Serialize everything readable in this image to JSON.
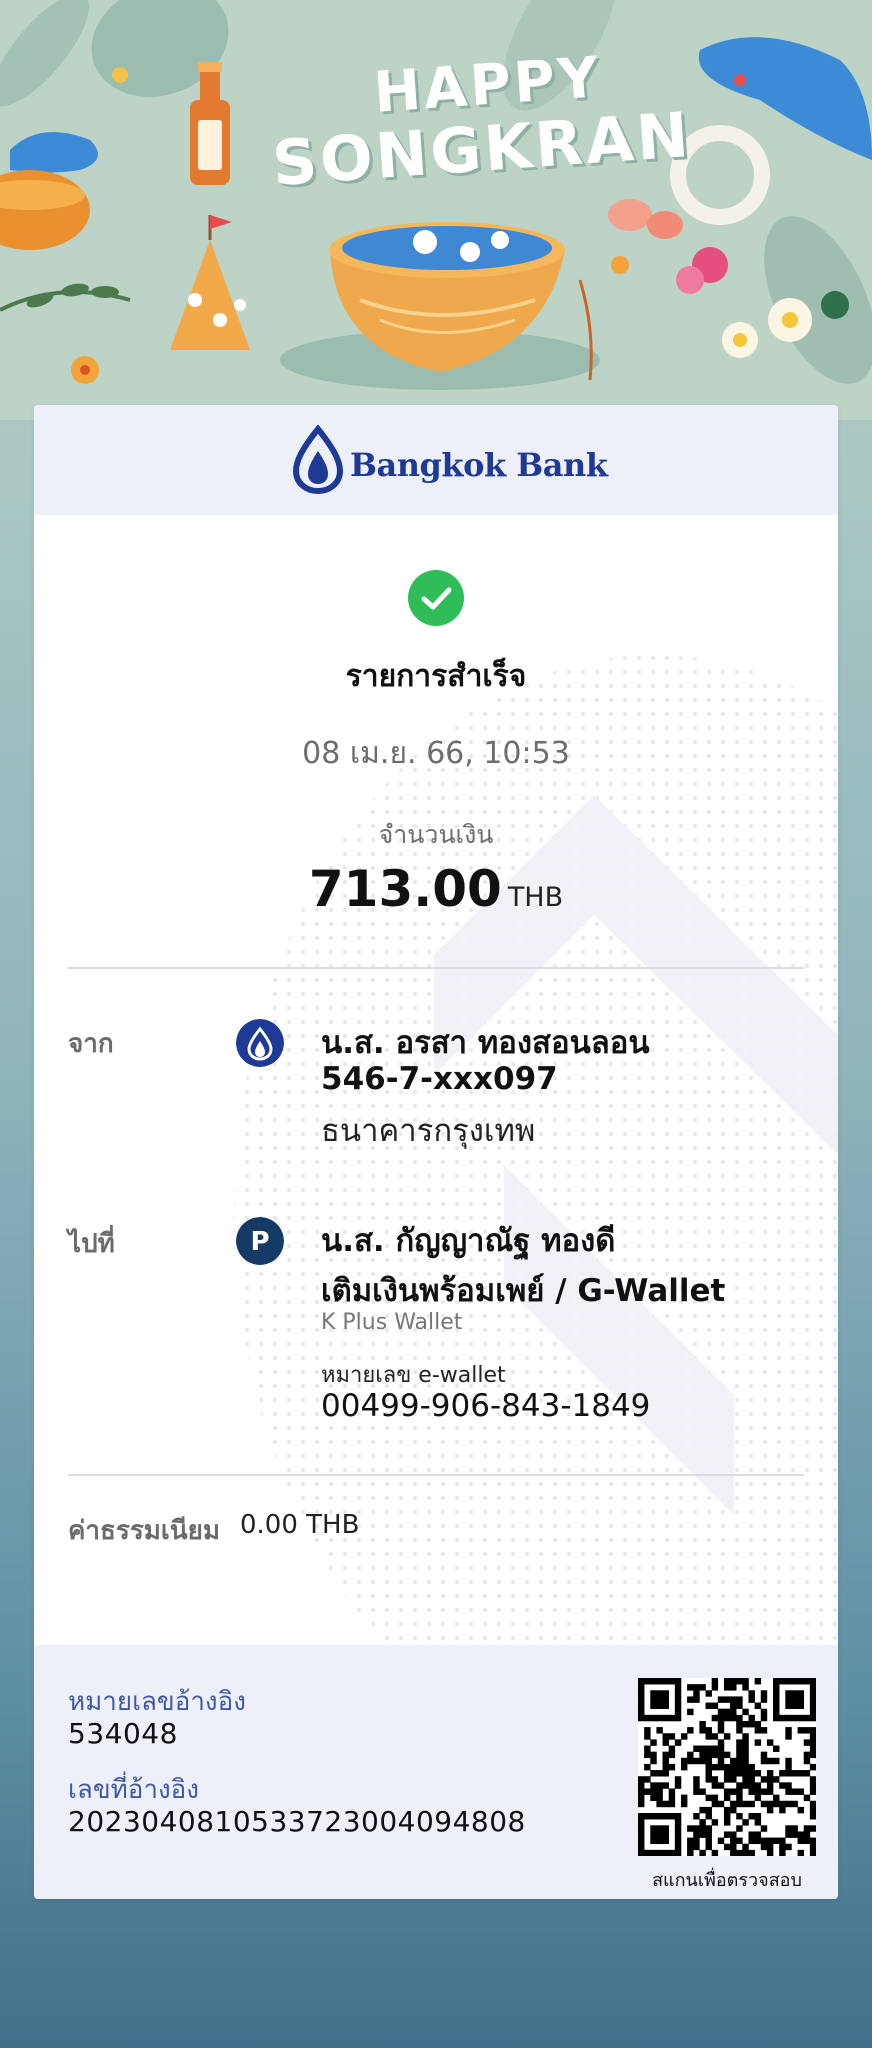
{
  "banner": {
    "title_line1": "HAPPY",
    "title_line2": "SONGKRAN"
  },
  "header": {
    "bank_name": "Bangkok Bank"
  },
  "status": {
    "icon": "check-circle-icon",
    "text": "รายการสำเร็จ",
    "datetime": "08 เม.ย. 66, 10:53"
  },
  "amount": {
    "label": "จำนวนเงิน",
    "value": "713.00",
    "currency": "THB"
  },
  "from": {
    "label": "จาก",
    "icon": "bangkok-bank-icon",
    "name": "น.ส. อรสา ทองสอนลอน",
    "account": "546-7-xxx097",
    "bank": "ธนาคารกรุงเทพ"
  },
  "to": {
    "label": "ไปที่",
    "icon": "promptpay-p-icon",
    "name": "น.ส. กัญญาณัฐ ทองดี",
    "service": "เติมเงินพร้อมเพย์ / G-Wallet",
    "provider": "K Plus Wallet",
    "wallet_label": "หมายเลข e-wallet",
    "wallet_number": "00499-906-843-1849"
  },
  "fee": {
    "label": "ค่าธรรมเนียม",
    "value": "0.00 THB"
  },
  "reference": {
    "ref_no_label": "หมายเลขอ้างอิง",
    "ref_no": "534048",
    "ref_id_label": "เลขที่อ้างอิง",
    "ref_id": "2023040810533723004094808",
    "qr_caption": "สแกนเพื่อตรวจสอบ"
  },
  "colors": {
    "brand_blue": "#1e3a96",
    "success_green": "#2ebd59",
    "promptpay_navy": "#163a66",
    "ref_label_blue": "#3f58a8"
  }
}
